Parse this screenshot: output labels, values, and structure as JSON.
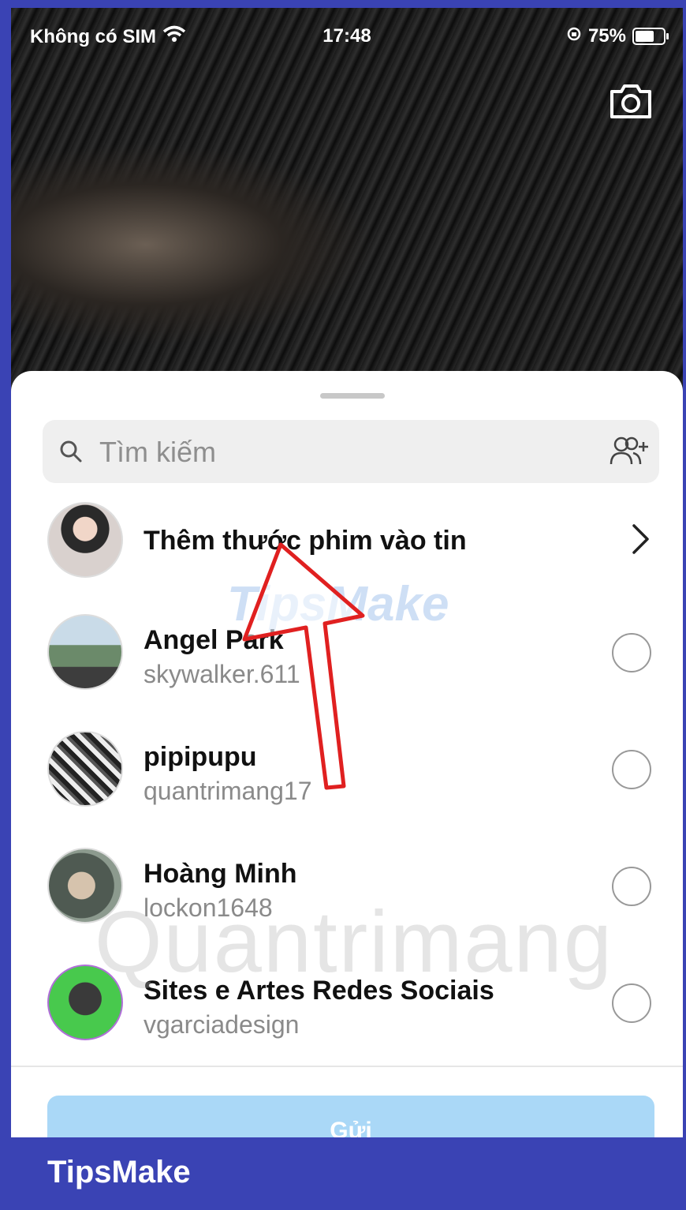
{
  "status_bar": {
    "carrier": "Không có SIM",
    "time": "17:48",
    "battery_percent": "75%",
    "battery_level": 0.75,
    "wifi_icon": "wifi-icon",
    "orientation_icon": "orientation-lock-icon"
  },
  "search": {
    "placeholder": "Tìm kiếm",
    "icon": "search-icon",
    "add_icon": "add-people-icon"
  },
  "add_to_story": {
    "label": "Thêm thước phim vào tin"
  },
  "contacts": [
    {
      "name": "Angel Park",
      "username": "skywalker.611"
    },
    {
      "name": "pipipupu",
      "username": "quantrimang17"
    },
    {
      "name": "Hoàng Minh",
      "username": "lockon1648"
    },
    {
      "name": "Sites e Artes Redes Sociais",
      "username": "vgarciadesign"
    }
  ],
  "send_button": {
    "label": "Gửi"
  },
  "watermarks": {
    "tipsmake": "TipsMake",
    "quantrimang": "Quantrimang"
  },
  "footer": {
    "brand": "TipsMake"
  },
  "colors": {
    "brand_blue": "#3a43b4",
    "send_button": "#aad8f7",
    "annotation_red": "#e02020"
  }
}
